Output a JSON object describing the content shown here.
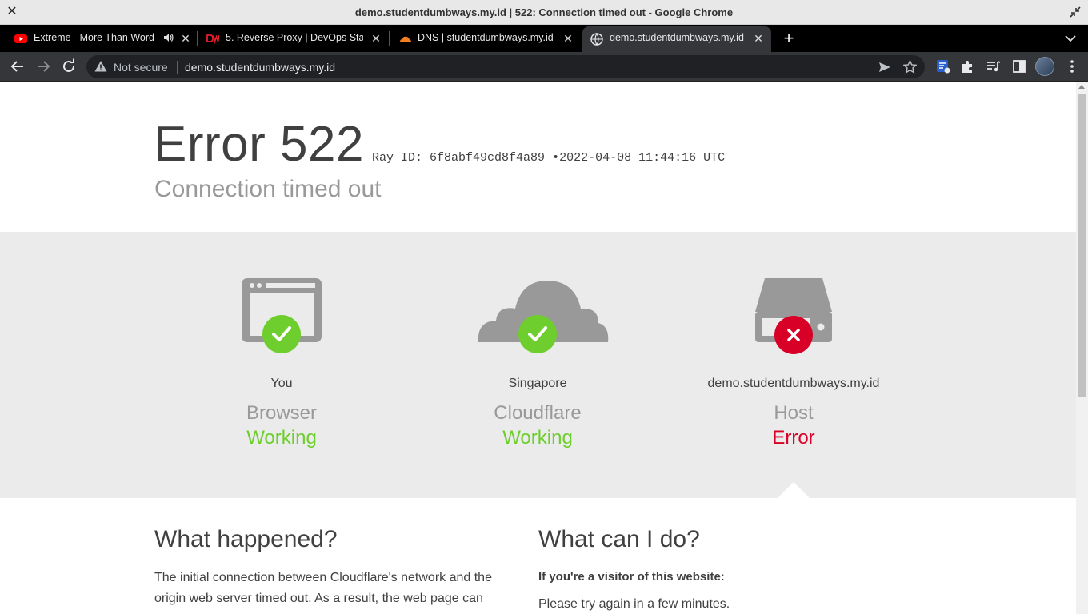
{
  "window": {
    "title": "demo.studentdumbways.my.id | 522: Connection timed out - Google Chrome"
  },
  "tabs": [
    {
      "label": "Extreme - More Than Words",
      "icon": "youtube-icon"
    },
    {
      "label": "5. Reverse Proxy | DevOps Stage",
      "icon": "dumbways-icon"
    },
    {
      "label": "DNS | studentdumbways.my.id",
      "icon": "cloudflare-icon"
    },
    {
      "label": "demo.studentdumbways.my.id",
      "icon": "globe-icon"
    }
  ],
  "toolbar": {
    "security_label": "Not secure",
    "url": "demo.studentdumbways.my.id"
  },
  "error": {
    "code_title": "Error 522",
    "ray_id_text": "Ray ID: 6f8abf49cd8f4a89",
    "bullet": "•",
    "timestamp": "2022-04-08 11:44:16 UTC",
    "subtitle": "Connection timed out"
  },
  "status": [
    {
      "location": "You",
      "kind": "Browser",
      "state": "Working",
      "ok": true,
      "icon": "browser-icon"
    },
    {
      "location": "Singapore",
      "kind": "Cloudflare",
      "state": "Working",
      "ok": true,
      "icon": "cloud-icon"
    },
    {
      "location": "demo.studentdumbways.my.id",
      "kind": "Host",
      "state": "Error",
      "ok": false,
      "icon": "server-icon"
    }
  ],
  "details": {
    "what_happened_heading": "What happened?",
    "what_happened_line1": "The initial connection between Cloudflare's network and the",
    "what_happened_line2": "origin web server timed out. As a result, the web page can",
    "what_can_i_do_heading": "What can I do?",
    "visitor_heading": "If you're a visitor of this website:",
    "visitor_text": "Please try again in a few minutes."
  },
  "colors": {
    "ok": "#6dce2e",
    "error": "#d80027",
    "icon_gray": "#999999"
  }
}
